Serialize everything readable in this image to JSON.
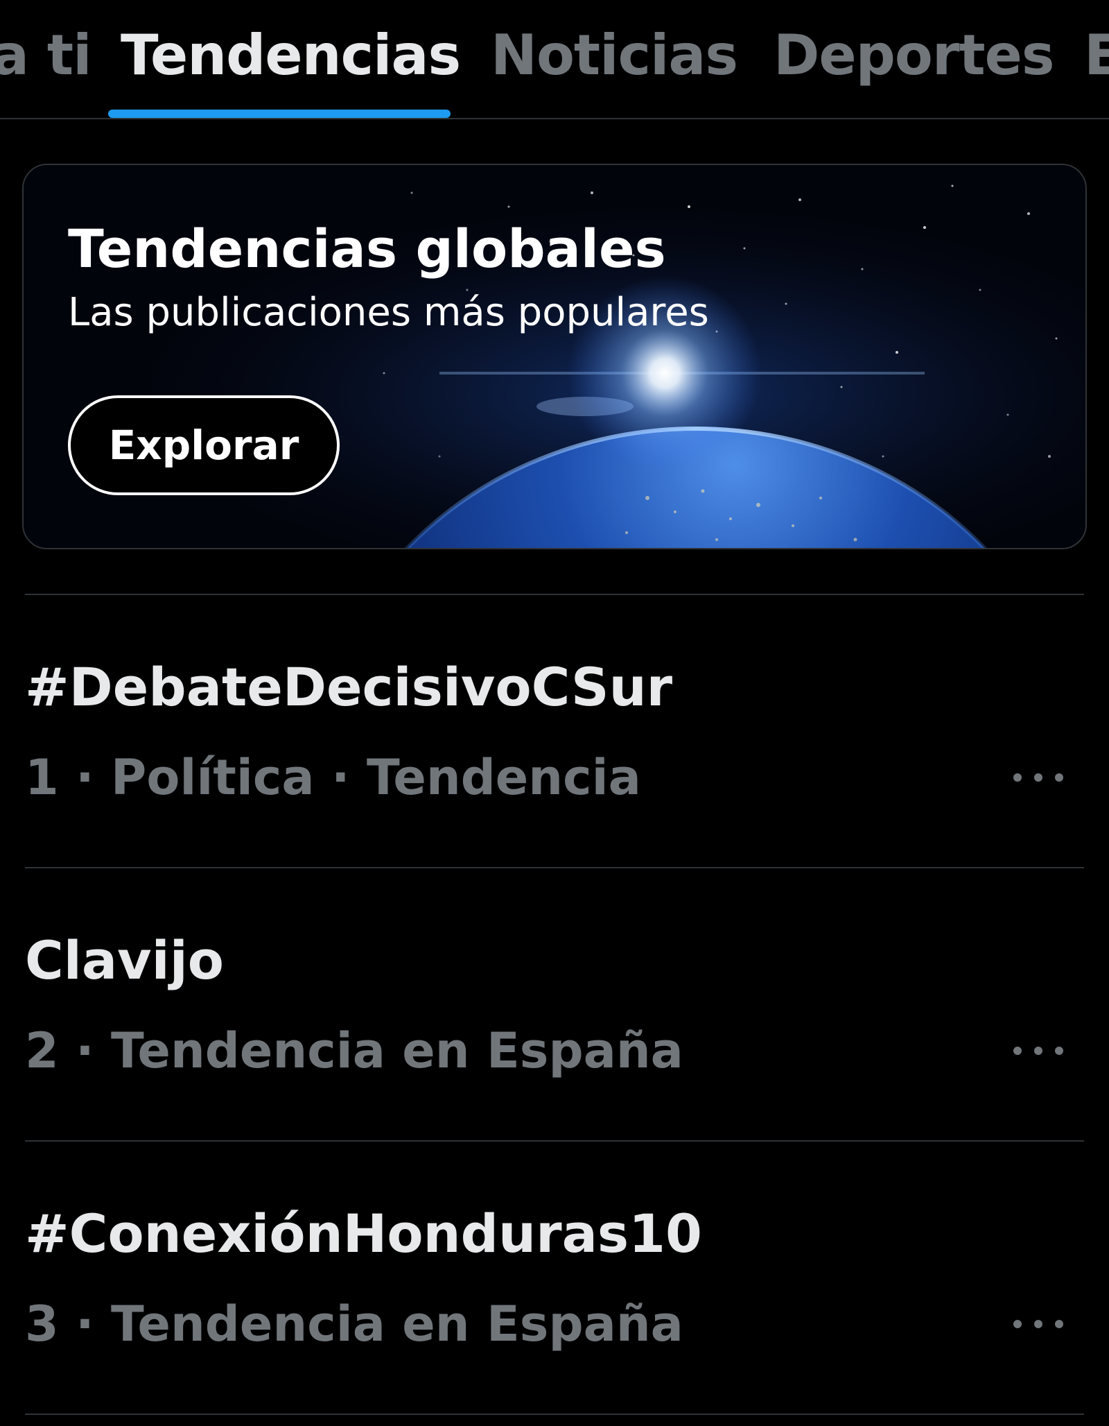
{
  "tabs": [
    {
      "label": "a ti",
      "active": false
    },
    {
      "label": "Tendencias",
      "active": true
    },
    {
      "label": "Noticias",
      "active": false
    },
    {
      "label": "Deportes",
      "active": false
    },
    {
      "label": "E",
      "active": false
    }
  ],
  "banner": {
    "title": "Tendencias globales",
    "subtitle": "Las publicaciones más populares",
    "button_label": "Explorar"
  },
  "trends": [
    {
      "name": "#DebateDecisivoCSur",
      "meta": "1 · Política · Tendencia",
      "more_icon": "ellipsis-icon"
    },
    {
      "name": "Clavijo",
      "meta": "2 · Tendencia en España",
      "more_icon": "ellipsis-icon"
    },
    {
      "name": "#ConexiónHonduras10",
      "meta": "3 · Tendencia en España",
      "more_icon": "ellipsis-icon"
    }
  ],
  "colors": {
    "background": "#000000",
    "accent": "#1d9bf0",
    "text_primary": "#e7e9ea",
    "text_secondary": "#71767b",
    "divider": "#2f3336"
  }
}
